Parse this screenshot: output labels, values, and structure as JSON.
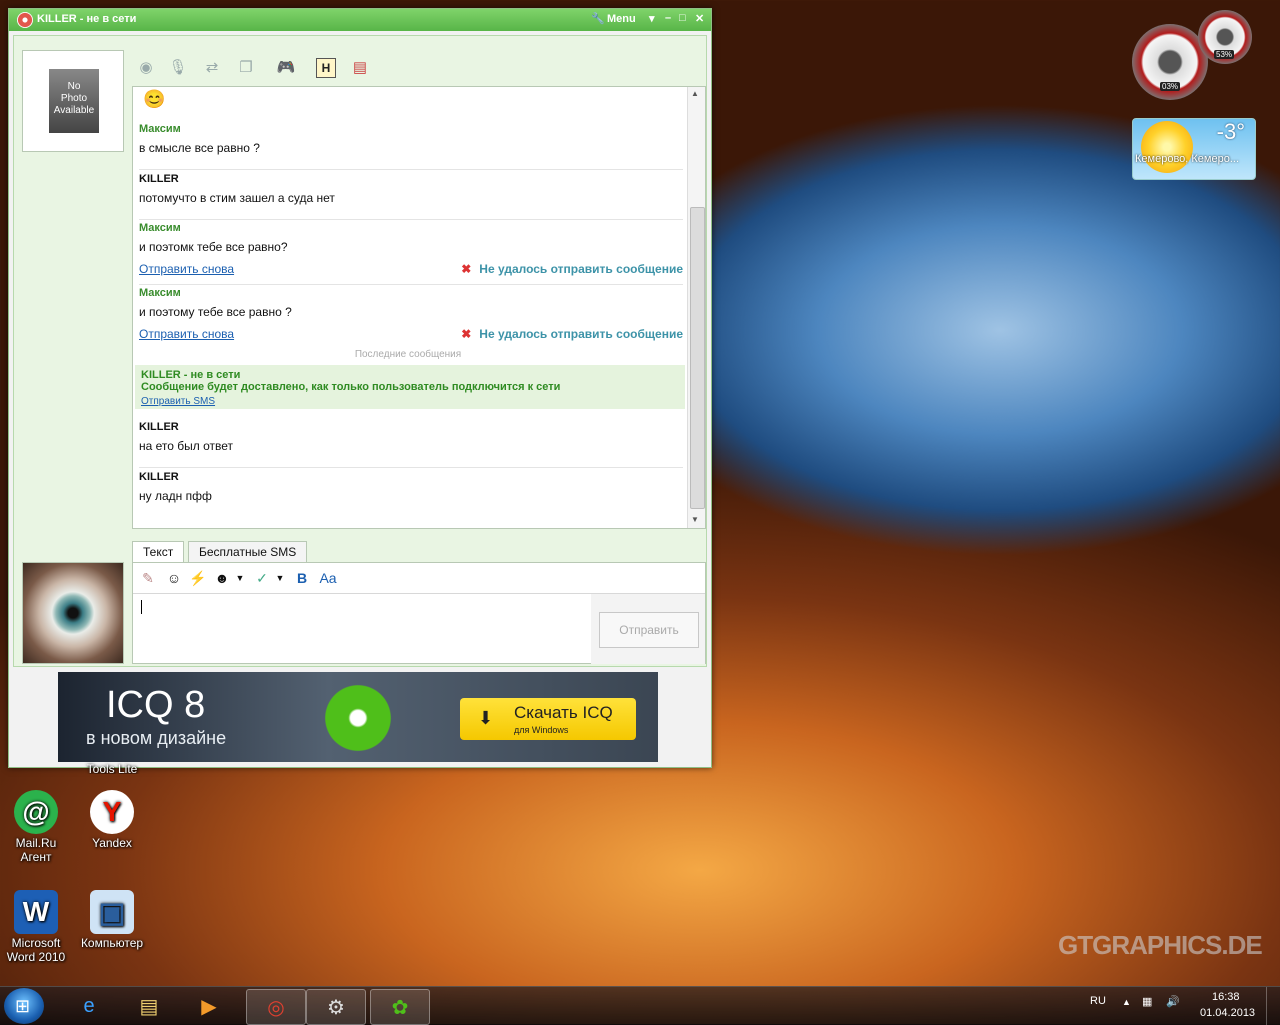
{
  "window": {
    "title": "KILLER - не в сети",
    "menu_label": "Menu",
    "controls": {
      "minimize": "–",
      "maximize": "□",
      "close": "✕"
    }
  },
  "contact_photo": {
    "text": "No\nPhoto\nAvailable"
  },
  "toolbar_icons": [
    "webcam-icon",
    "microphone-icon",
    "file-transfer-icon",
    "multi-window-icon",
    "gamepad-icon",
    "history-icon",
    "contact-card-icon"
  ],
  "chat": {
    "messages": [
      {
        "author": "Максим",
        "text": "в смысле все равно ?",
        "own": false
      },
      {
        "author": "KILLER",
        "text": "потомучто в стим зашел а суда нет",
        "own": true
      },
      {
        "author": "Максим",
        "text": "и поэтомк тебе все равно?",
        "own": false,
        "resend": "Отправить снова",
        "error": "Не удалось отправить сообщение"
      },
      {
        "author": "Максим",
        "text": "и поэтому  тебе все равно ?",
        "own": false,
        "resend": "Отправить снова",
        "error": "Не удалось отправить сообщение"
      }
    ],
    "divider": "Последние сообщения",
    "offline_notice": {
      "title": "KILLER - не в сети",
      "body": "Сообщение будет доставлено, как только пользователь подключится к сети",
      "link": "Отправить SMS"
    },
    "recent_messages": [
      {
        "author": "KILLER",
        "text": "на ето был ответ"
      },
      {
        "author": "KILLER",
        "text": "ну ладн пфф"
      }
    ]
  },
  "tabs": [
    {
      "label": "Текст",
      "active": true
    },
    {
      "label": "Бесплатные SMS",
      "active": false
    }
  ],
  "composer": {
    "value": "",
    "send_label": "Отправить"
  },
  "banner": {
    "title": "ICQ 8",
    "subtitle": "в новом дизайне",
    "download_label": "Скачать ICQ",
    "download_sub": "для Windows"
  },
  "desktop_icons": [
    {
      "label": "Mail.Ru\nАгент",
      "icon": "mailru-agent-icon"
    },
    {
      "label": "Yandex",
      "icon": "yandex-icon"
    },
    {
      "label": "Microsoft\nWord 2010",
      "icon": "word-icon"
    },
    {
      "label": "Компьютер",
      "icon": "computer-icon"
    }
  ],
  "desktop_partial_label": "Tools Lite",
  "gadgets": {
    "cpu_percent": "03%",
    "ram_percent": "53%",
    "weather": {
      "temp": "-3°",
      "city": "Кемерово, Кемеро..."
    }
  },
  "watermark": "GTGRAPHICS.DE",
  "taskbar": {
    "language": "RU",
    "time": "16:38",
    "date": "01.04.2013",
    "apps": [
      "ie-icon",
      "explorer-icon",
      "media-player-icon",
      "chrome-icon",
      "steam-icon",
      "icq-icon"
    ]
  },
  "colors": {
    "icq_green": "#58b548",
    "author_green": "#3a8d2e",
    "link_blue": "#1b5fb0",
    "error_teal": "#3d93a8"
  }
}
